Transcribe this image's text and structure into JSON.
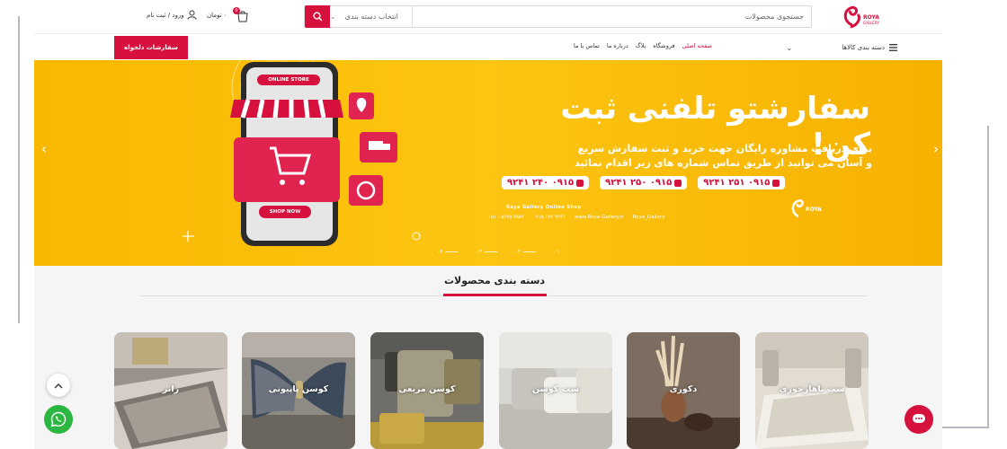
{
  "header": {
    "logo_text": "ROYA GALLERY",
    "search_placeholder": "جستجوی محصولات",
    "category_select": "انتخاب دسته بندی",
    "cart_count": "0",
    "cart_price": "۰ تومان",
    "login_label": "ورود / ثبت نام"
  },
  "nav": {
    "all_categories": "دسته بندی کالاها",
    "links": [
      "صفحه اصلی",
      "فروشگاه",
      "بلاگ",
      "درباره ما",
      "تماس با ما"
    ],
    "custom_order": "سفارشات دلخواه"
  },
  "banner": {
    "headline": "سفارشتو تلفنی ثبت کن!",
    "sub1": "برای دریافت مشاوره رایگان جهت خرید و ثبت سفارش سریع",
    "sub2": "و آسان می توانید از طریق تماس شماره های زیر اقدام نمائید",
    "phones": [
      "۰۹۱۵ ۲۵۱ ۹۲۴۱",
      "۰۹۱۵ ۲۵۰ ۹۲۴۱",
      "۰۹۱۵ ۲۴۰ ۹۲۴۱"
    ],
    "online_store_label": "ONLINE STORE",
    "shop_now_label": "SHOP NOW",
    "shop_label": "Roya Gallery Online Shop",
    "contacts": [
      "۰۵۱ - ۵۷۲۵ ۹۹۸۷",
      "۰۹۱۵ ۱۷۷ ۹۲۴۱",
      "www.Roya-Gallery.ir",
      "Roya_Gallery"
    ],
    "slides": [
      "۰۴",
      "۰۳",
      "۰۲",
      "۰۱"
    ]
  },
  "section": {
    "title": "دسته بندی محصولات"
  },
  "categories": [
    {
      "label": "ست ناهارخوری",
      "bg": "#d9d2c7"
    },
    {
      "label": "دکوری",
      "bg": "#7a6a5e"
    },
    {
      "label": "ست کوسن",
      "bg": "#c9c6c0"
    },
    {
      "label": "کوسن مربعی",
      "bg": "#8a8a86"
    },
    {
      "label": "کوسن پاپیونی",
      "bg": "#8f8b84"
    },
    {
      "label": "رانر",
      "bg": "#a49d96"
    }
  ],
  "colors": {
    "brand": "#d6113e",
    "banner": "#fcc512",
    "whatsapp": "#2bb741"
  }
}
